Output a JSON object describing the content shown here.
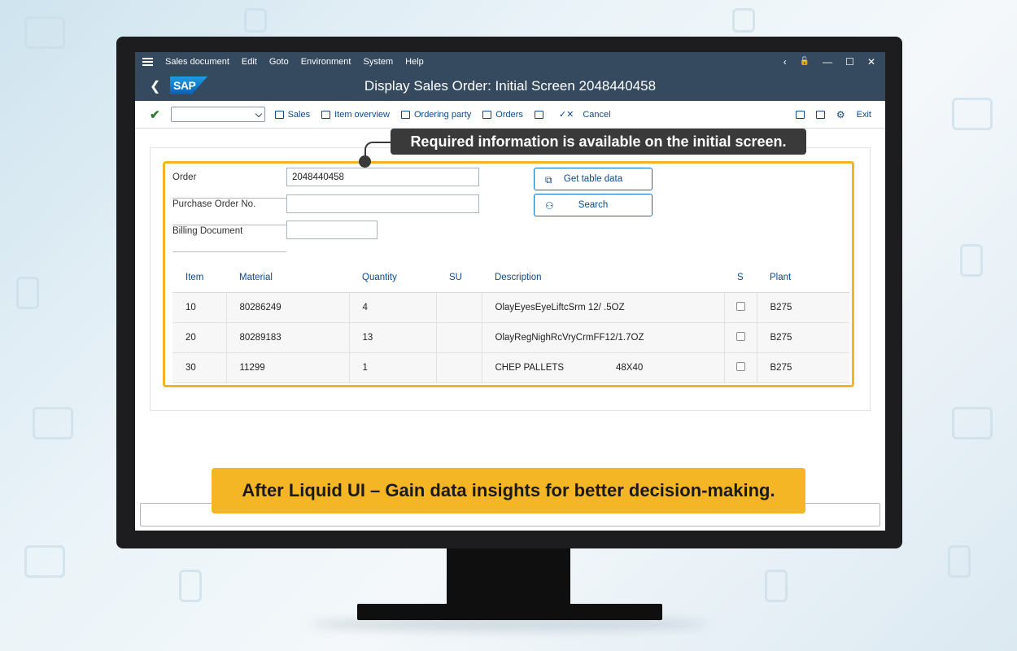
{
  "menu": {
    "items": [
      "Sales document",
      "Edit",
      "Goto",
      "Environment",
      "System",
      "Help"
    ]
  },
  "window_controls": {
    "back": "‹",
    "lock": "🔓",
    "minimize": "—",
    "maximize": "☐",
    "close": "✕"
  },
  "header": {
    "logo_text": "SAP",
    "title": "Display Sales Order: Initial Screen 2048440458"
  },
  "toolbar": {
    "dropdown_value": "",
    "items": [
      "Sales",
      "Item overview",
      "Ordering party",
      "Orders",
      "Cancel"
    ],
    "exit_label": "Exit"
  },
  "form": {
    "order_label": "Order",
    "order_value": "2048440458",
    "po_label": "Purchase Order No.",
    "po_value": "",
    "billing_label": "Billing Document",
    "billing_value": "",
    "get_table_data_label": "Get table data",
    "search_label": "Search"
  },
  "table": {
    "columns": [
      "Item",
      "Material",
      "Quantity",
      "SU",
      "Description",
      "S",
      "Plant"
    ],
    "rows": [
      {
        "item": "10",
        "material": "80286249",
        "quantity": "4",
        "su": "",
        "description": "OlayEyesEyeLiftcSrm 12/ .5OZ",
        "s": false,
        "plant": "B275"
      },
      {
        "item": "20",
        "material": "80289183",
        "quantity": "13",
        "su": "",
        "description": "OlayRegNighRcVryCrmFF12/1.7OZ",
        "s": false,
        "plant": "B275"
      },
      {
        "item": "30",
        "material": "11299",
        "quantity": "1",
        "su": "",
        "description": "CHEP PALLETS                    48X40",
        "s": false,
        "plant": "B275"
      }
    ]
  },
  "callout": "Required information is available on the initial screen.",
  "banner": "After Liquid UI – Gain data insights for better decision-making.",
  "colors": {
    "shell": "#354a5f",
    "highlight": "#f2b521",
    "banner": "#f5b625",
    "link": "#0a4a8f"
  }
}
